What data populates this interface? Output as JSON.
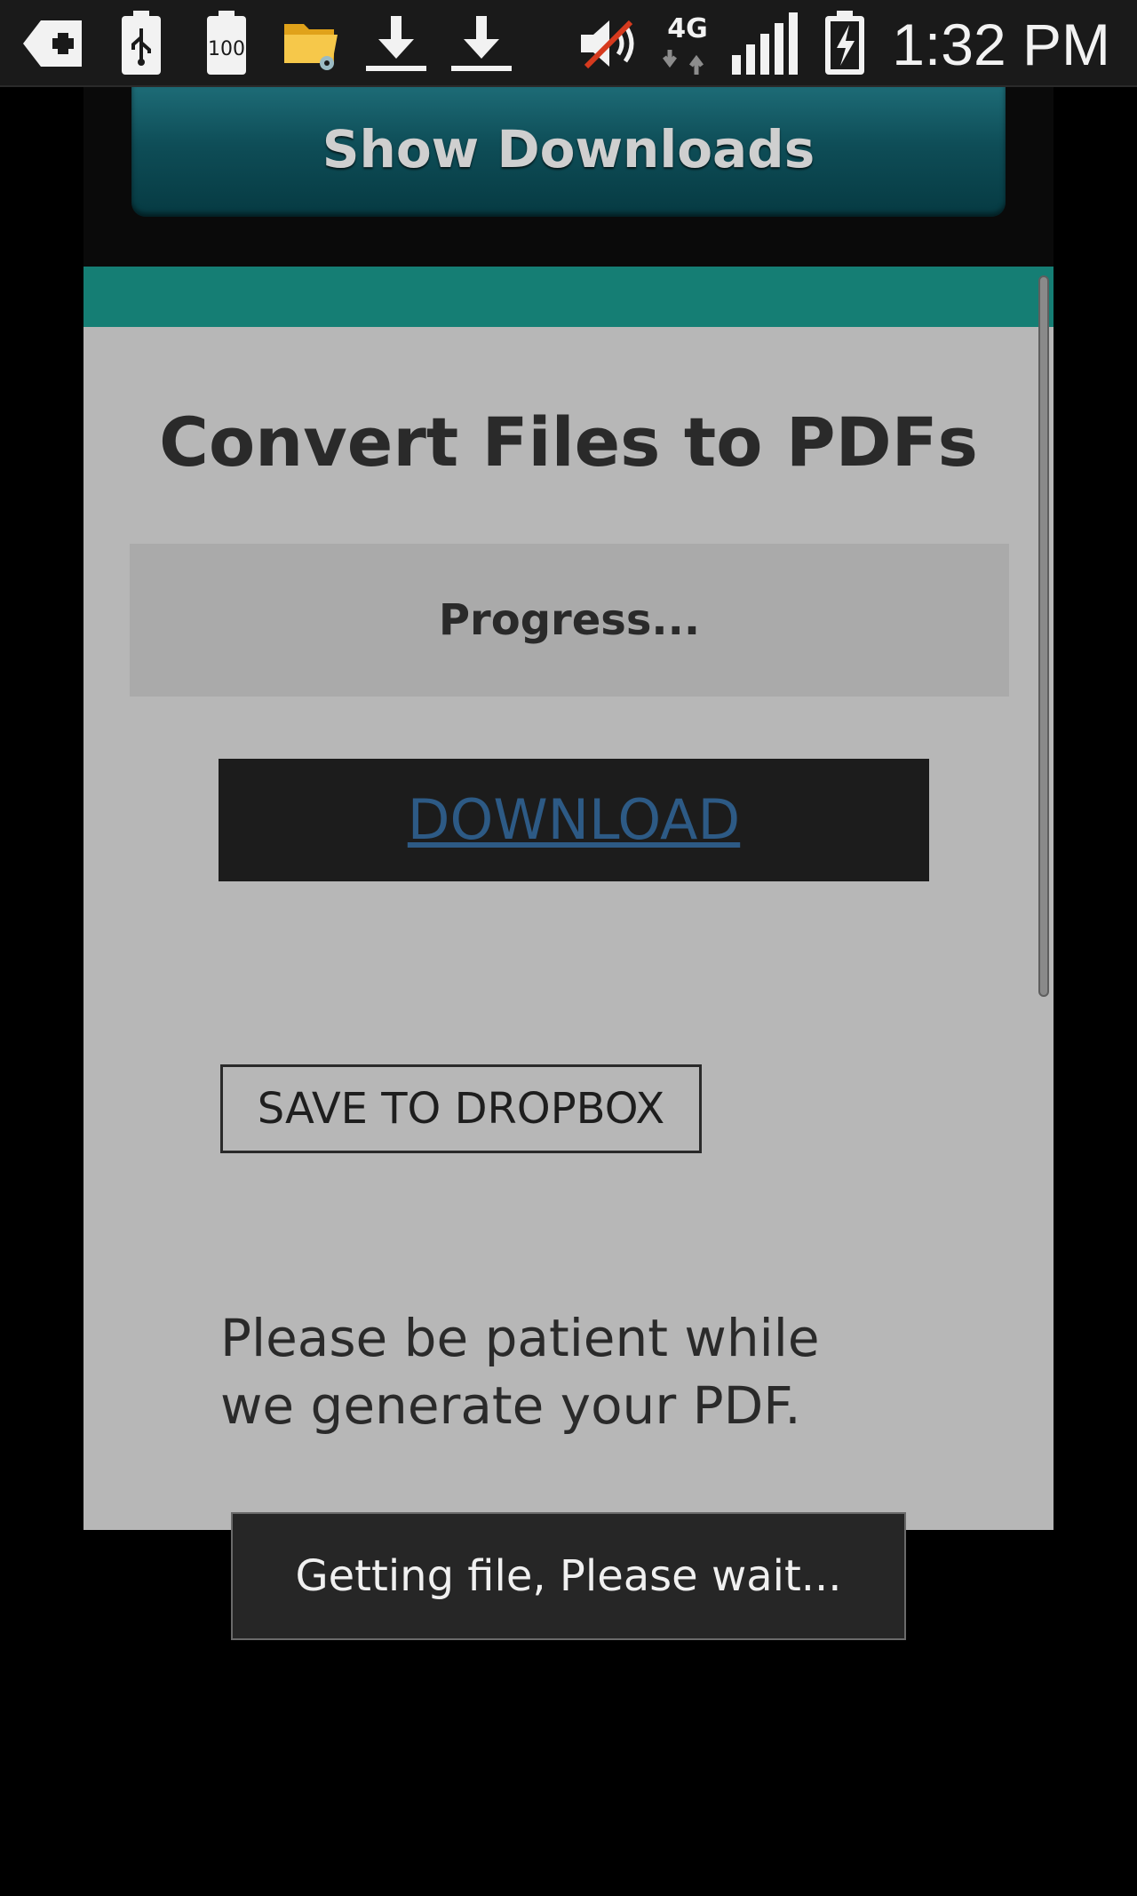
{
  "status_bar": {
    "time": "1:32 PM",
    "network": "4G",
    "icons": [
      "plus-notification-icon",
      "usb-icon",
      "battery-100-icon",
      "folder-icon",
      "download-icon",
      "download-icon",
      "mute-icon",
      "network-4g-icon",
      "signal-icon",
      "battery-charging-icon"
    ],
    "battery_100_label": "100"
  },
  "header": {
    "show_downloads_label": "Show Downloads"
  },
  "panel": {
    "title": "Convert Files to PDFs",
    "progress_label": "Progress...",
    "download_label": "DOWNLOAD",
    "dropbox_label": "SAVE TO DROPBOX",
    "patience_line1": "Please be patient while",
    "patience_line2": "we generate your PDF."
  },
  "toast": {
    "message": "Getting file, Please wait..."
  },
  "colors": {
    "teal_bar": "#157e74",
    "panel_bg": "#b7b7b7",
    "download_link": "#2d5a85"
  }
}
